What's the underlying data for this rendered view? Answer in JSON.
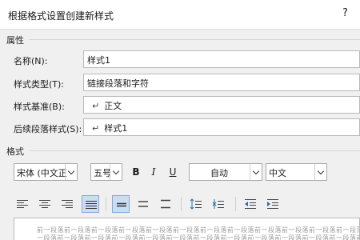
{
  "dialog": {
    "title": "根据格式设置创建新样式",
    "help": "?"
  },
  "properties": {
    "heading": "属性",
    "fields": [
      {
        "label": "名称(N):",
        "value": "样式1",
        "arrow": ""
      },
      {
        "label": "样式类型(T):",
        "value": "链接段落和字符",
        "arrow": ""
      },
      {
        "label": "样式基准(B):",
        "value": "正文",
        "arrow": "↵"
      },
      {
        "label": "后续段落样式(S):",
        "value": "样式1",
        "arrow": "↵"
      }
    ]
  },
  "format": {
    "heading": "格式",
    "font": "宋体 (中文正文)",
    "size": "五号",
    "bold": "B",
    "italic": "I",
    "underline": "U",
    "color": "自动",
    "script": "中文"
  },
  "preview": {
    "line1": "前一段落前一段落前一段落前一段落前一段落前一段落前一段落前一段落前一段落前一段落前一段落前一段落",
    "line2": "一段落前一段落前一段落前一段落前一段落前一段落前一段落前一段落前一段落前一段落前一段落前一段落前"
  },
  "colors": {
    "active_button": "#c9ddf3",
    "icon_blue": "#2b6cb0"
  }
}
